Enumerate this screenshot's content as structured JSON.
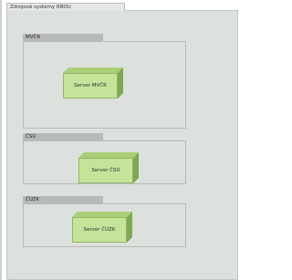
{
  "diagram": {
    "title": "Zdrojové systémy RBOU",
    "groups": [
      {
        "label": "MVČR",
        "node": "Server MVČR"
      },
      {
        "label": "ČSÚ",
        "node": "Server ČSÚ"
      },
      {
        "label": "ČÚZK",
        "node": "Server ČÚZK"
      }
    ]
  },
  "colors": {
    "background": "#dde1de",
    "group_tab": "#b8bab9",
    "node_face": "#c5e49a",
    "node_top": "#a9cf77",
    "node_side": "#7fa851"
  }
}
